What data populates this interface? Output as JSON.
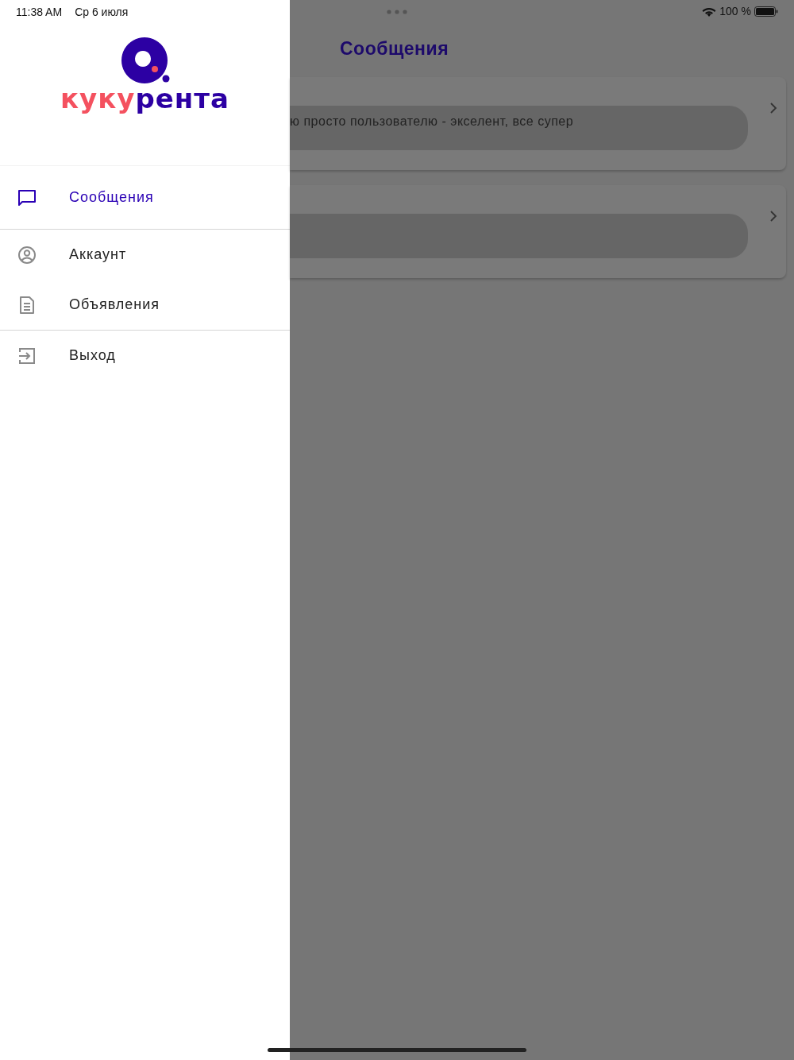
{
  "status_bar": {
    "time": "11:38 AM",
    "date": "Ср 6 июля",
    "battery": "100 %"
  },
  "drawer": {
    "logo": {
      "wordmark": [
        {
          "text": "куку",
          "color": "#f4515f"
        },
        {
          "text": "рента",
          "color": "#2c00a3"
        }
      ]
    },
    "sections": [
      {
        "items": [
          {
            "label": "Сообщения",
            "selected": true
          }
        ]
      },
      {
        "items": [
          {
            "label": "Аккаунт",
            "selected": false
          },
          {
            "label": "Объявления",
            "selected": false
          }
        ]
      },
      {
        "items": [
          {
            "label": "Выход",
            "selected": false
          }
        ]
      }
    ]
  },
  "screen": {
    "title": "Сообщения",
    "messages": [
      {
        "kind": "text",
        "text": "ю просто пользователю - экселент, все супер"
      },
      {
        "kind": "blank"
      }
    ]
  }
}
